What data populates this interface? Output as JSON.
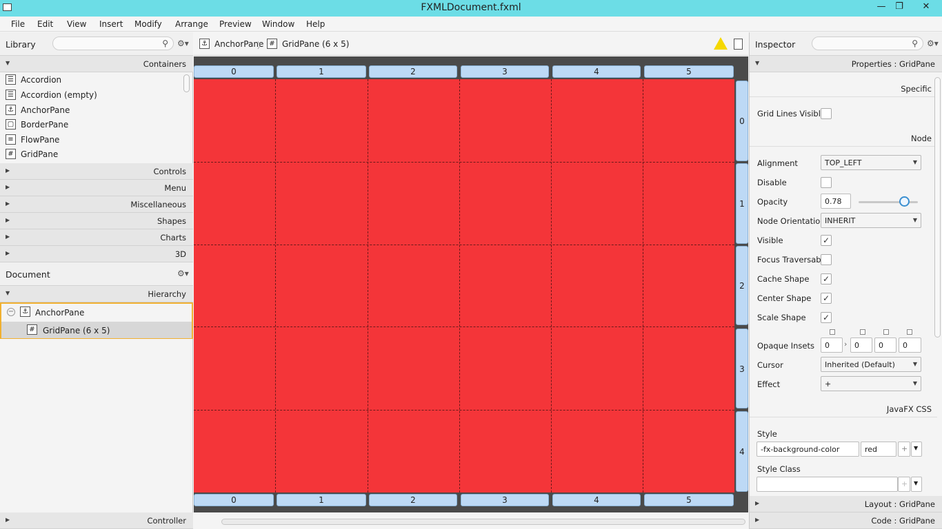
{
  "window": {
    "title": "FXMLDocument.fxml",
    "minimize": "—",
    "restore": "❐",
    "close": "✕"
  },
  "menu": [
    "File",
    "Edit",
    "View",
    "Insert",
    "Modify",
    "Arrange",
    "Preview",
    "Window",
    "Help"
  ],
  "library": {
    "title": "Library",
    "sections": {
      "containers": "Containers",
      "controls": "Controls",
      "menu": "Menu",
      "misc": "Miscellaneous",
      "shapes": "Shapes",
      "charts": "Charts",
      "threed": "3D"
    },
    "items": [
      "Accordion",
      "Accordion  (empty)",
      "AnchorPane",
      "BorderPane",
      "FlowPane",
      "GridPane"
    ]
  },
  "document": {
    "title": "Document",
    "hierarchy_label": "Hierarchy",
    "tree": {
      "root": "AnchorPane",
      "child": "GridPane (6 x 5)"
    },
    "controller_label": "Controller"
  },
  "breadcrumb": {
    "item1": "AnchorPane",
    "item2": "GridPane (6 x 5)"
  },
  "grid": {
    "columns": [
      "0",
      "1",
      "2",
      "3",
      "4",
      "5"
    ],
    "rows": [
      "0",
      "1",
      "2",
      "3",
      "4"
    ],
    "color": "#f43539"
  },
  "inspector": {
    "title": "Inspector",
    "properties_label": "Properties : GridPane",
    "specific_label": "Specific",
    "grid_lines_label": "Grid Lines Visible",
    "node_label": "Node",
    "alignment_label": "Alignment",
    "alignment_value": "TOP_LEFT",
    "disable_label": "Disable",
    "opacity_label": "Opacity",
    "opacity_value": "0.78",
    "node_orientation_label": "Node Orientation",
    "node_orientation_value": "INHERIT",
    "visible_label": "Visible",
    "focus_label": "Focus Traversable",
    "cache_shape_label": "Cache Shape",
    "center_shape_label": "Center Shape",
    "scale_shape_label": "Scale Shape",
    "opaque_insets_label": "Opaque Insets",
    "insets": [
      "0",
      "0",
      "0",
      "0"
    ],
    "cursor_label": "Cursor",
    "cursor_value": "Inherited (Default)",
    "effect_label": "Effect",
    "effect_value": "+",
    "css_label": "JavaFX CSS",
    "style_label": "Style",
    "style_prop": "-fx-background-color",
    "style_value": "red",
    "style_class_label": "Style Class",
    "layout_label": "Layout : GridPane",
    "code_label": "Code : GridPane"
  }
}
